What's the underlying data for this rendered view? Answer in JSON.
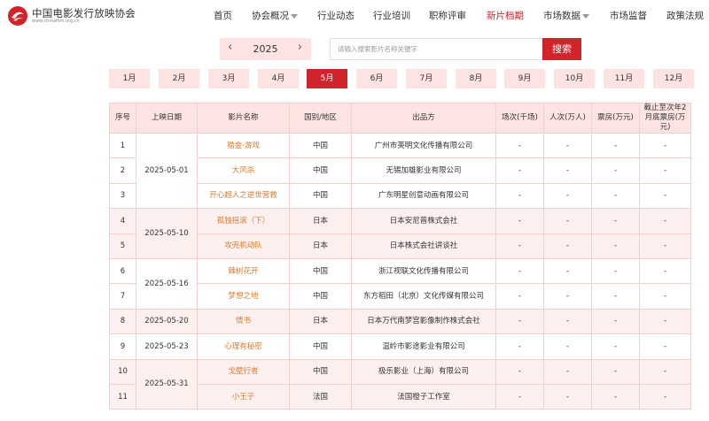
{
  "site": {
    "name": "中国电影发行放映协会",
    "domain": "www.chinafilm.org.cn"
  },
  "nav": {
    "items": [
      {
        "label": "首页",
        "dropdown": false,
        "active": false
      },
      {
        "label": "协会概况",
        "dropdown": true,
        "active": false
      },
      {
        "label": "行业动态",
        "dropdown": false,
        "active": false
      },
      {
        "label": "行业培训",
        "dropdown": false,
        "active": false
      },
      {
        "label": "职称评审",
        "dropdown": false,
        "active": false
      },
      {
        "label": "新片档期",
        "dropdown": false,
        "active": true
      },
      {
        "label": "市场数据",
        "dropdown": true,
        "active": false
      },
      {
        "label": "市场监督",
        "dropdown": false,
        "active": false
      },
      {
        "label": "政策法规",
        "dropdown": false,
        "active": false
      }
    ]
  },
  "year_selector": {
    "prev": "‹",
    "year": "2025",
    "next": "›"
  },
  "search": {
    "placeholder": "请输入搜索影片名称关键字",
    "button": "搜索"
  },
  "months": {
    "items": [
      "1月",
      "2月",
      "3月",
      "4月",
      "5月",
      "6月",
      "7月",
      "8月",
      "9月",
      "10月",
      "11月",
      "12月"
    ],
    "active_index": 4
  },
  "table": {
    "headers": [
      "序号",
      "上映日期",
      "影片名称",
      "国别/地区",
      "出品方",
      "场次(千场)",
      "人次(万人)",
      "票房(万元)",
      "截止至次年2月底票房(万元)"
    ],
    "rows": [
      {
        "no": "1",
        "date": "2025-05-01",
        "film": "猎金·游戏",
        "country": "中国",
        "producer": "广州市英明文化传播有限公司",
        "shows": "-",
        "admissions": "-",
        "boxoffice": "-",
        "cumulative": "-"
      },
      {
        "no": "2",
        "date": "2025-05-01",
        "film": "大风杀",
        "country": "中国",
        "producer": "无锡加雄影业有限公司",
        "shows": "-",
        "admissions": "-",
        "boxoffice": "-",
        "cumulative": "-"
      },
      {
        "no": "3",
        "date": "2025-05-01",
        "film": "开心超人之逆世营救",
        "country": "中国",
        "producer": "广东明星创意动画有限公司",
        "shows": "-",
        "admissions": "-",
        "boxoffice": "-",
        "cumulative": "-"
      },
      {
        "no": "4",
        "date": "2025-05-10",
        "film": "孤独摇滚（下）",
        "country": "日本",
        "producer": "日本安尼普株式会社",
        "shows": "-",
        "admissions": "-",
        "boxoffice": "-",
        "cumulative": "-"
      },
      {
        "no": "5",
        "date": "2025-05-10",
        "film": "攻壳机动队",
        "country": "日本",
        "producer": "日本株式会社讲谈社",
        "shows": "-",
        "admissions": "-",
        "boxoffice": "-",
        "cumulative": "-"
      },
      {
        "no": "6",
        "date": "2025-05-16",
        "film": "棘树花开",
        "country": "中国",
        "producer": "浙江视联文化传播有限公司",
        "shows": "-",
        "admissions": "-",
        "boxoffice": "-",
        "cumulative": "-"
      },
      {
        "no": "7",
        "date": "2025-05-16",
        "film": "梦想之地",
        "country": "中国",
        "producer": "东方稻田（北京）文化传媒有限公司",
        "shows": "-",
        "admissions": "-",
        "boxoffice": "-",
        "cumulative": "-"
      },
      {
        "no": "8",
        "date": "2025-05-20",
        "film": "情书",
        "country": "日本",
        "producer": "日本万代南梦宫影像制作株式会社",
        "shows": "-",
        "admissions": "-",
        "boxoffice": "-",
        "cumulative": "-"
      },
      {
        "no": "9",
        "date": "2025-05-23",
        "film": "心理有秘密",
        "country": "中国",
        "producer": "温岭市影途影业有限公司",
        "shows": "-",
        "admissions": "-",
        "boxoffice": "-",
        "cumulative": "-"
      },
      {
        "no": "10",
        "date": "2025-05-31",
        "film": "戈壁行者",
        "country": "中国",
        "producer": "极乐影业（上海）有限公司",
        "shows": "-",
        "admissions": "-",
        "boxoffice": "-",
        "cumulative": "-"
      },
      {
        "no": "11",
        "date": "2025-05-31",
        "film": "小王子",
        "country": "法国",
        "producer": "法国橙子工作室",
        "shows": "-",
        "admissions": "-",
        "boxoffice": "-",
        "cumulative": "-"
      }
    ]
  },
  "colors": {
    "accent": "#d0232b",
    "tab_bg": "#fde3e1",
    "link": "#e07a2e",
    "row_pink": "#fdf0ef"
  }
}
